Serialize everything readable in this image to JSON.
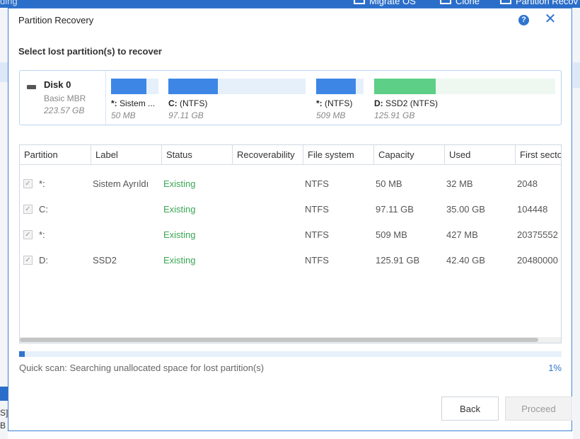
{
  "background": {
    "left_fragment_top": "ding",
    "toolbar": [
      {
        "label": "Migrate OS",
        "icon": "migrate-os-icon"
      },
      {
        "label": "Clone",
        "icon": "clone-icon"
      },
      {
        "label": "Partition Recov",
        "icon": "partition-recovery-icon"
      }
    ],
    "left_fragment_mid": "S]",
    "left_fragment_bottom": "B"
  },
  "dialog": {
    "title": "Partition Recovery",
    "subtitle": "Select lost partition(s) to recover",
    "help_icon": "?",
    "close_icon": "✕"
  },
  "disk": {
    "name": "Disk 0",
    "type": "Basic MBR",
    "size": "223.57 GB",
    "segments": [
      {
        "letter": "*:",
        "name": "Sistem ...",
        "size": "50 MB",
        "fill": 0.74,
        "color": "#3d86e6"
      },
      {
        "letter": "C:",
        "name": "(NTFS)",
        "size": "97.11 GB",
        "fill": 0.36,
        "color": "#3d86e6"
      },
      {
        "letter": "*:",
        "name": "(NTFS)",
        "size": "509 MB",
        "fill": 0.84,
        "color": "#3d86e6"
      },
      {
        "letter": "D:",
        "name": "SSD2 (NTFS)",
        "size": "125.91 GB",
        "fill": 0.34,
        "color": "#5dcf86"
      }
    ]
  },
  "table": {
    "columns": [
      "Partition",
      "Label",
      "Status",
      "Recoverability",
      "File system",
      "Capacity",
      "Used",
      "First secto"
    ],
    "rows": [
      {
        "partition": "*:",
        "label": "Sistem Ayrıldı",
        "status": "Existing",
        "recoverability": "",
        "filesystem": "NTFS",
        "capacity": "50 MB",
        "used": "32 MB",
        "first_sector": "2048",
        "checked": true
      },
      {
        "partition": "C:",
        "label": "",
        "status": "Existing",
        "recoverability": "",
        "filesystem": "NTFS",
        "capacity": "97.11 GB",
        "used": "35.00 GB",
        "first_sector": "104448",
        "checked": true
      },
      {
        "partition": "*:",
        "label": "",
        "status": "Existing",
        "recoverability": "",
        "filesystem": "NTFS",
        "capacity": "509 MB",
        "used": "427 MB",
        "first_sector": "20375552",
        "checked": true
      },
      {
        "partition": "D:",
        "label": "SSD2",
        "status": "Existing",
        "recoverability": "",
        "filesystem": "NTFS",
        "capacity": "125.91 GB",
        "used": "42.40 GB",
        "first_sector": "20480000",
        "checked": true
      }
    ]
  },
  "scan": {
    "text": "Quick scan: Searching unallocated space for lost partition(s)",
    "percent_label": "1%",
    "progress": 0.01
  },
  "buttons": {
    "back": "Back",
    "proceed": "Proceed"
  },
  "colors": {
    "accent": "#2f74d0",
    "status_existing": "#3aa655"
  }
}
